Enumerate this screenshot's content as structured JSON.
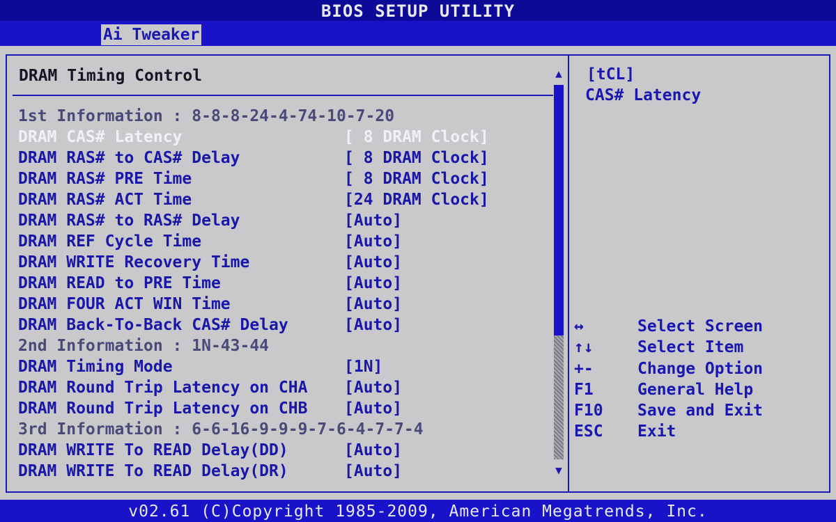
{
  "window": {
    "title": "BIOS SETUP UTILITY",
    "active_tab": "Ai Tweaker"
  },
  "panel": {
    "heading": "DRAM Timing Control",
    "rows": [
      {
        "label": "1st Information : 8-8-8-24-4-74-10-7-20",
        "value": "",
        "kind": "info"
      },
      {
        "label": "DRAM CAS# Latency",
        "value": "[ 8 DRAM Clock]",
        "kind": "selected"
      },
      {
        "label": "DRAM RAS# to CAS# Delay",
        "value": "[ 8 DRAM Clock]",
        "kind": "opt"
      },
      {
        "label": "DRAM RAS# PRE Time",
        "value": "[ 8 DRAM Clock]",
        "kind": "opt"
      },
      {
        "label": "DRAM RAS# ACT Time",
        "value": "[24 DRAM Clock]",
        "kind": "opt"
      },
      {
        "label": "DRAM RAS# to RAS# Delay",
        "value": "[Auto]",
        "kind": "opt"
      },
      {
        "label": "DRAM REF Cycle Time",
        "value": "[Auto]",
        "kind": "opt"
      },
      {
        "label": "DRAM WRITE Recovery Time",
        "value": "[Auto]",
        "kind": "opt"
      },
      {
        "label": "DRAM READ to PRE Time",
        "value": "[Auto]",
        "kind": "opt"
      },
      {
        "label": "DRAM FOUR ACT WIN Time",
        "value": "[Auto]",
        "kind": "opt"
      },
      {
        "label": "DRAM Back-To-Back CAS# Delay",
        "value": "[Auto]",
        "kind": "opt"
      },
      {
        "label": "2nd Information : 1N-43-44",
        "value": "",
        "kind": "info"
      },
      {
        "label": "DRAM Timing Mode",
        "value": "[1N]",
        "kind": "opt"
      },
      {
        "label": "DRAM Round Trip Latency on CHA",
        "value": "[Auto]",
        "kind": "opt"
      },
      {
        "label": "DRAM Round Trip Latency on CHB",
        "value": "[Auto]",
        "kind": "opt"
      },
      {
        "label": "3rd Information : 6-6-16-9-9-9-7-6-4-7-7-4",
        "value": "",
        "kind": "info"
      },
      {
        "label": "DRAM WRITE To READ Delay(DD)",
        "value": "[Auto]",
        "kind": "opt"
      },
      {
        "label": "DRAM WRITE To READ Delay(DR)",
        "value": "[Auto]",
        "kind": "opt"
      }
    ]
  },
  "scrollbar": {
    "up_glyph": "▲",
    "down_glyph": "▼"
  },
  "help": {
    "title": "[tCL]",
    "description": "CAS# Latency",
    "keys": [
      {
        "key": "↔",
        "desc": "Select Screen"
      },
      {
        "key": "↑↓",
        "desc": "Select Item"
      },
      {
        "key": "+-",
        "desc": "Change Option"
      },
      {
        "key": "F1",
        "desc": "General Help"
      },
      {
        "key": "F10",
        "desc": "Save and Exit"
      },
      {
        "key": "ESC",
        "desc": "Exit"
      }
    ]
  },
  "footer": {
    "text": "v02.61 (C)Copyright 1985-2009, American Megatrends, Inc."
  },
  "colors": {
    "background_blue": "#0e0a98",
    "panel_gray": "#c9c9cc",
    "option_blue": "#1a17a8",
    "selected_white": "#f0f0f6",
    "info_gray": "#4a4a78"
  }
}
